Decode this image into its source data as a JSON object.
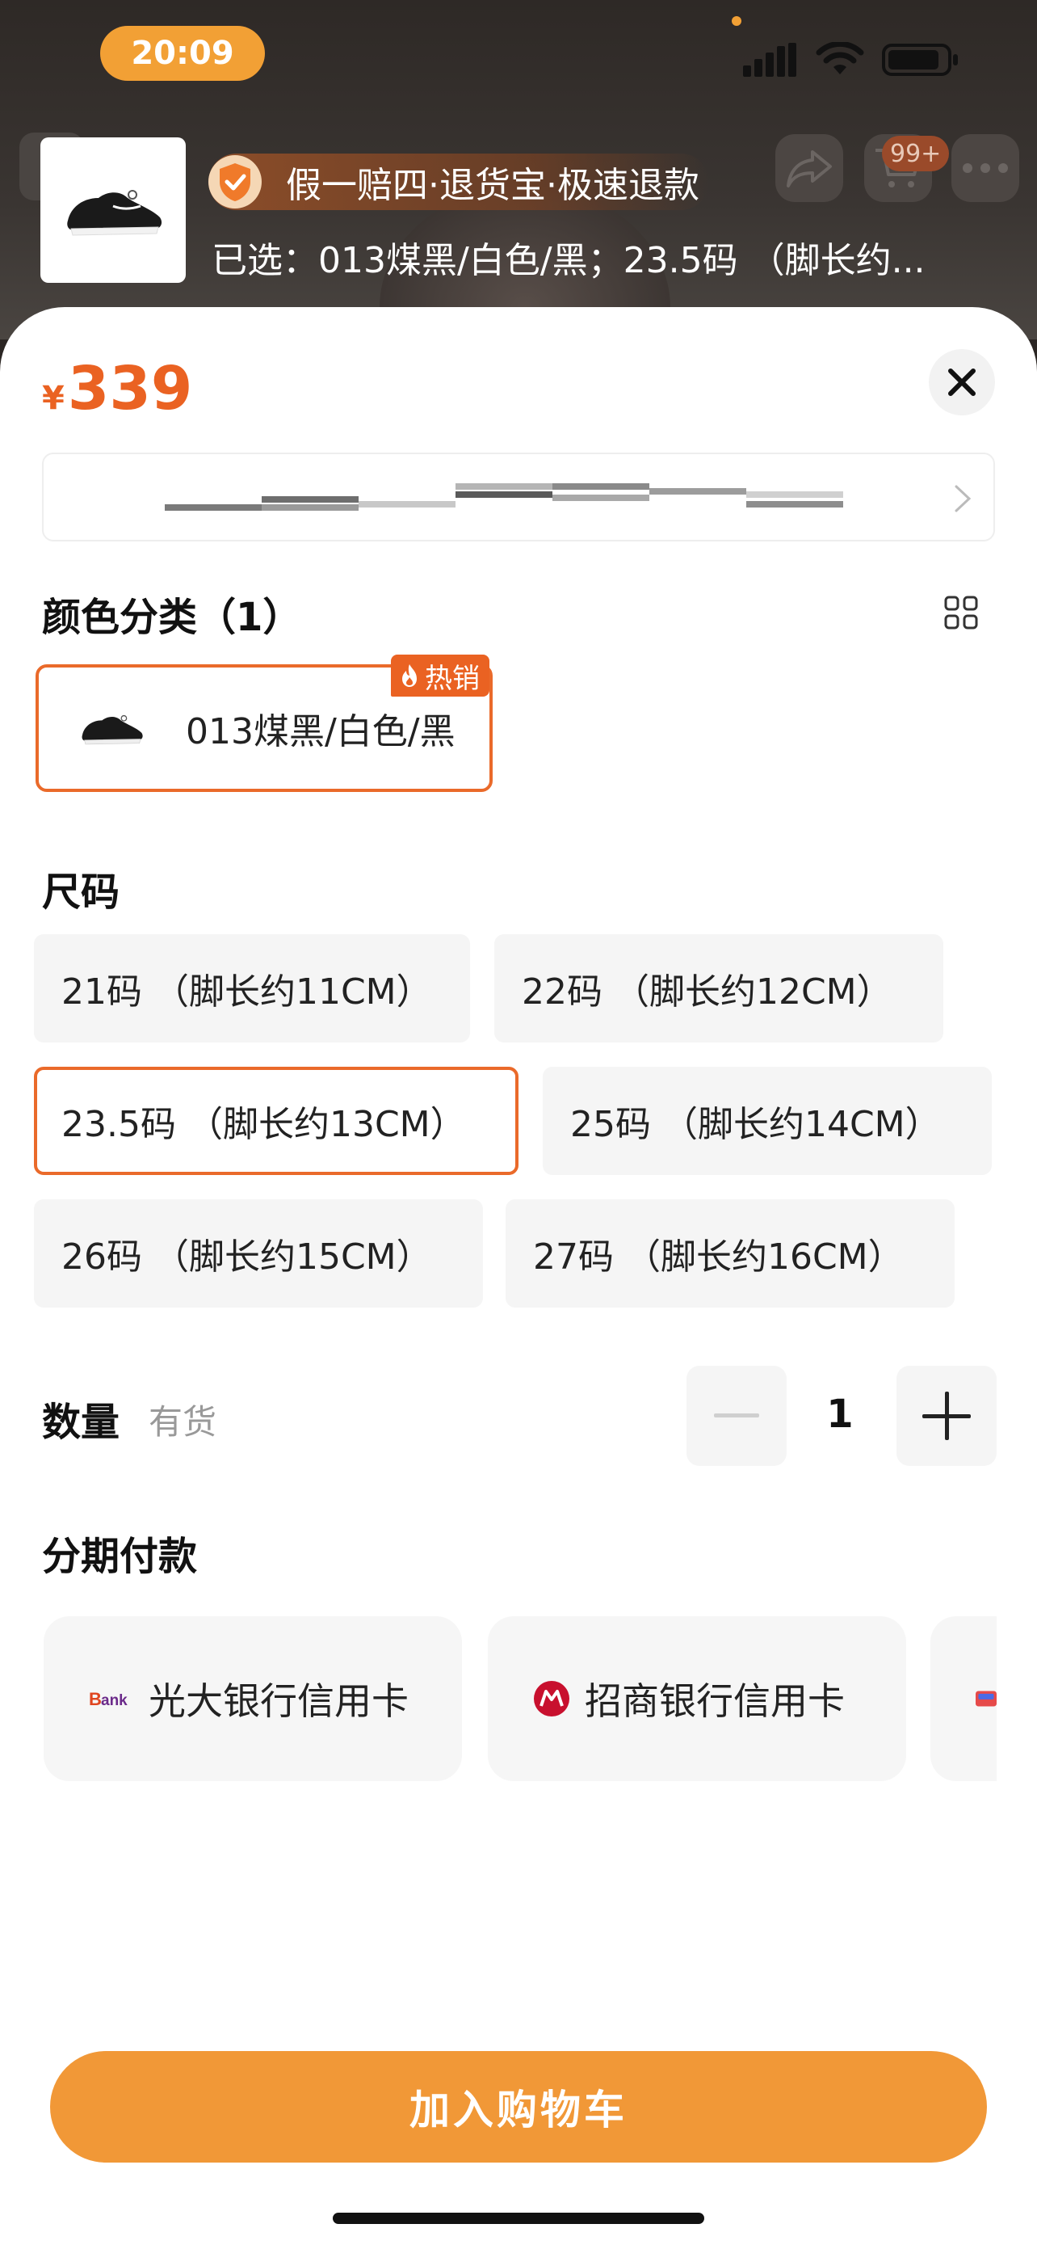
{
  "status_bar": {
    "time": "20:09"
  },
  "top_bar": {
    "cart_badge": "99+"
  },
  "product_header": {
    "guarantee": "假一赔四·退货宝·极速退款",
    "selected_text": "已选：013煤黑/白色/黑；23.5码 （脚长约..."
  },
  "price": {
    "symbol": "¥",
    "value": "339"
  },
  "color_section": {
    "title": "颜色分类（1）",
    "options": [
      {
        "label": "013煤黑/白色/黑",
        "tag": "热销",
        "selected": true
      }
    ]
  },
  "size_section": {
    "title": "尺码",
    "options": [
      {
        "label": "21码 （脚长约11CM）",
        "selected": false
      },
      {
        "label": "22码 （脚长约12CM）",
        "selected": false
      },
      {
        "label": "23.5码 （脚长约13CM）",
        "selected": true
      },
      {
        "label": "25码 （脚长约14CM）",
        "selected": false
      },
      {
        "label": "26码 （脚长约15CM）",
        "selected": false
      },
      {
        "label": "27码 （脚长约16CM）",
        "selected": false
      }
    ]
  },
  "quantity": {
    "label": "数量",
    "stock": "有货",
    "value": "1"
  },
  "installment": {
    "title": "分期付款",
    "cards": [
      {
        "label": "光大银行信用卡",
        "icon": "ceb-bank-icon"
      },
      {
        "label": "招商银行信用卡",
        "icon": "cmb-bank-icon"
      },
      {
        "label": "",
        "icon": "huabei-icon"
      }
    ]
  },
  "actions": {
    "add_to_cart": "加入购物车"
  },
  "colors": {
    "accent": "#ea6222",
    "button": "#f19837",
    "status_pill": "#f2a035"
  }
}
